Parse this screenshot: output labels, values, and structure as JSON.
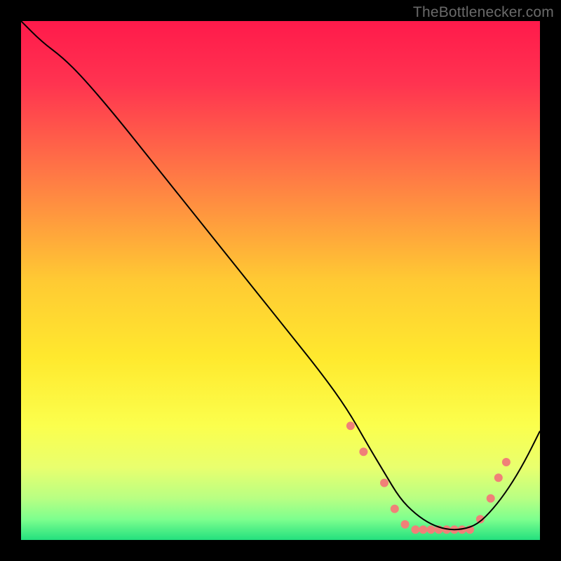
{
  "watermark": "TheBottlenecker.com",
  "chart_data": {
    "type": "line",
    "title": "",
    "xlabel": "",
    "ylabel": "",
    "xlim": [
      0,
      100
    ],
    "ylim": [
      0,
      100
    ],
    "grid": false,
    "background": {
      "style": "vertical-gradient",
      "stops": [
        {
          "offset": 0.0,
          "color": "#ff1a4b"
        },
        {
          "offset": 0.12,
          "color": "#ff3350"
        },
        {
          "offset": 0.3,
          "color": "#ff7a45"
        },
        {
          "offset": 0.5,
          "color": "#ffca33"
        },
        {
          "offset": 0.65,
          "color": "#ffe92e"
        },
        {
          "offset": 0.78,
          "color": "#fbff4d"
        },
        {
          "offset": 0.86,
          "color": "#e9ff6e"
        },
        {
          "offset": 0.92,
          "color": "#b8ff83"
        },
        {
          "offset": 0.96,
          "color": "#7dff8e"
        },
        {
          "offset": 1.0,
          "color": "#23e07e"
        }
      ]
    },
    "series": [
      {
        "name": "curve",
        "color": "#000000",
        "stroke_width": 2,
        "x": [
          0,
          4,
          8,
          12,
          18,
          26,
          34,
          42,
          50,
          58,
          63,
          67,
          70,
          73,
          76,
          79,
          82,
          85,
          88,
          91,
          94,
          97,
          100
        ],
        "y": [
          100,
          96,
          93,
          89,
          82,
          72,
          62,
          52,
          42,
          32,
          25,
          18,
          13,
          8,
          5,
          3,
          2,
          2,
          3,
          6,
          10,
          15,
          21
        ]
      }
    ],
    "markers": {
      "color": "#f08078",
      "radius": 6,
      "points": [
        {
          "x": 63.5,
          "y": 22
        },
        {
          "x": 66.0,
          "y": 17
        },
        {
          "x": 70.0,
          "y": 11
        },
        {
          "x": 72.0,
          "y": 6
        },
        {
          "x": 74.0,
          "y": 3
        },
        {
          "x": 76.0,
          "y": 2
        },
        {
          "x": 77.5,
          "y": 2
        },
        {
          "x": 79.0,
          "y": 2
        },
        {
          "x": 80.5,
          "y": 2
        },
        {
          "x": 82.0,
          "y": 2
        },
        {
          "x": 83.5,
          "y": 2
        },
        {
          "x": 85.0,
          "y": 2
        },
        {
          "x": 86.5,
          "y": 2
        },
        {
          "x": 88.5,
          "y": 4
        },
        {
          "x": 90.5,
          "y": 8
        },
        {
          "x": 92.0,
          "y": 12
        },
        {
          "x": 93.5,
          "y": 15
        }
      ]
    }
  }
}
